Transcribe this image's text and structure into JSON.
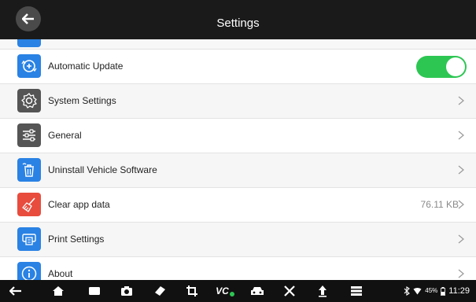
{
  "header": {
    "title": "Settings"
  },
  "settings_rows": [
    {
      "label": "Automatic Update",
      "icon": "update-icon",
      "icon_color": "#2a82e4",
      "toggle": true,
      "toggle_state": "on",
      "value": ""
    },
    {
      "label": "System Settings",
      "icon": "gear-icon",
      "icon_color": "#555555",
      "toggle": false,
      "value": ""
    },
    {
      "label": "General",
      "icon": "sliders-icon",
      "icon_color": "#555555",
      "toggle": false,
      "value": ""
    },
    {
      "label": "Uninstall Vehicle Software",
      "icon": "trash-icon",
      "icon_color": "#2a82e4",
      "toggle": false,
      "value": ""
    },
    {
      "label": "Clear app data",
      "icon": "broom-icon",
      "icon_color": "#e84c3d",
      "toggle": false,
      "value": "76.11 KB"
    },
    {
      "label": "Print Settings",
      "icon": "printer-icon",
      "icon_color": "#2a82e4",
      "toggle": false,
      "value": ""
    },
    {
      "label": "About",
      "icon": "info-icon",
      "icon_color": "#2a82e4",
      "toggle": false,
      "value": ""
    }
  ],
  "navbar": {
    "icons": [
      "back-icon",
      "home-icon",
      "recent-apps-icon",
      "camera-icon",
      "eraser-icon",
      "crop-icon",
      "vci-icon",
      "car-icon",
      "tools-icon",
      "upload-icon",
      "menu-icon"
    ],
    "vci_label": "VC",
    "battery": "45%",
    "time": "11:29"
  },
  "colors": {
    "header_bg": "#1a1a1a",
    "toggle_on": "#2dc653",
    "accent_blue": "#2a82e4",
    "accent_red": "#e84c3d"
  }
}
